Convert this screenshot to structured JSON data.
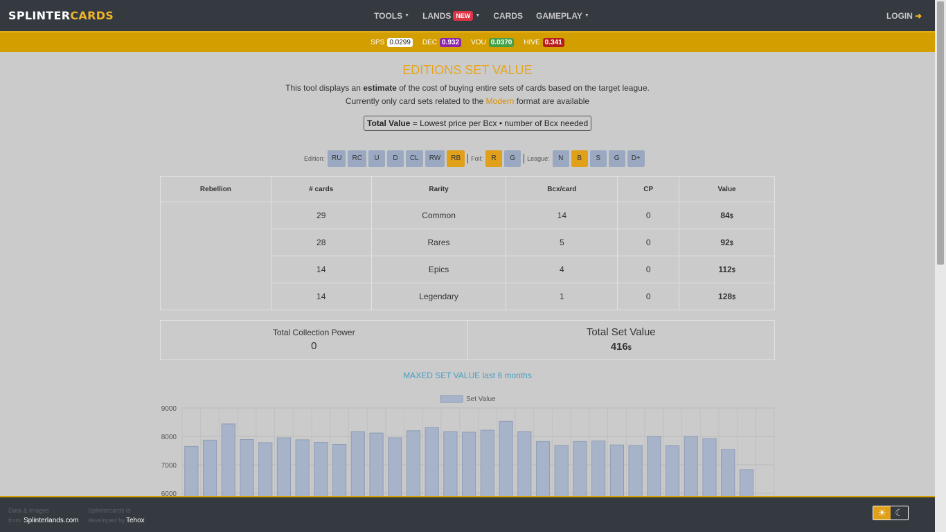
{
  "brand": {
    "part1": "SPLINTER",
    "part2": "CARDS"
  },
  "nav": {
    "items": [
      {
        "label": "TOOLS",
        "dropdown": true
      },
      {
        "label": "LANDS",
        "badge": "NEW",
        "dropdown": true
      },
      {
        "label": "CARDS",
        "dropdown": false
      },
      {
        "label": "GAMEPLAY",
        "dropdown": true
      }
    ],
    "login": "LOGIN"
  },
  "prices": [
    {
      "symbol": "SPS",
      "value": "0.0299",
      "color": "#ffffff"
    },
    {
      "symbol": "DEC",
      "value": "0.932",
      "color": "#8e24aa"
    },
    {
      "symbol": "VOU",
      "value": "0.0370",
      "color": "#43a047"
    },
    {
      "symbol": "HIVE",
      "value": "0.341",
      "color": "#b71c1c"
    }
  ],
  "header": {
    "title": "EDITIONS SET VALUE",
    "line1_pre": "This tool displays an ",
    "line1_bold": "estimate",
    "line1_post": " of the cost of buying entire sets of cards based on the target league.",
    "line2_pre": "Currently only card sets related to the ",
    "line2_hl": "Modern",
    "line2_post": " format are available",
    "formula_bold": "Total Value",
    "formula_rest": " = Lowest price per Bcx • number of Bcx needed"
  },
  "filters": {
    "edition_label": "Edition:",
    "editions": [
      {
        "label": "RU",
        "active": false
      },
      {
        "label": "RC",
        "active": false
      },
      {
        "label": "U",
        "active": false
      },
      {
        "label": "D",
        "active": false
      },
      {
        "label": "CL",
        "active": false
      },
      {
        "label": "RW",
        "active": false
      },
      {
        "label": "RB",
        "active": true
      }
    ],
    "foil_label": "Foil:",
    "foils": [
      {
        "label": "R",
        "active": true
      },
      {
        "label": "G",
        "active": false
      }
    ],
    "league_label": "League:",
    "leagues": [
      {
        "label": "N",
        "active": false
      },
      {
        "label": "B",
        "active": true
      },
      {
        "label": "S",
        "active": false
      },
      {
        "label": "G",
        "active": false
      },
      {
        "label": "D+",
        "active": false
      }
    ]
  },
  "table": {
    "edition": "Rebellion",
    "headers": [
      "# cards",
      "Rarity",
      "Bcx/card",
      "CP",
      "Value"
    ],
    "rows": [
      {
        "cards": "29",
        "rarity": "Common",
        "bcx": "14",
        "cp": "0",
        "value": "84"
      },
      {
        "cards": "28",
        "rarity": "Rares",
        "bcx": "5",
        "cp": "0",
        "value": "92"
      },
      {
        "cards": "14",
        "rarity": "Epics",
        "bcx": "4",
        "cp": "0",
        "value": "112"
      },
      {
        "cards": "14",
        "rarity": "Legendary",
        "bcx": "1",
        "cp": "0",
        "value": "128"
      }
    ],
    "currency": "$"
  },
  "totals": {
    "cp_label": "Total Collection Power",
    "cp_value": "0",
    "set_label": "Total Set Value",
    "set_value": "416",
    "currency": "$"
  },
  "chart_title": "MAXED SET VALUE last 6 months",
  "chart_data": {
    "type": "bar",
    "series": [
      {
        "name": "Set Value",
        "values": [
          7650,
          7870,
          8440,
          7890,
          7780,
          7950,
          7880,
          7790,
          7720,
          8170,
          8120,
          7950,
          8200,
          8310,
          8170,
          8150,
          8220,
          8530,
          8170,
          7820,
          7680,
          7820,
          7840,
          7700,
          7680,
          7990,
          7670,
          8000,
          7920,
          7540,
          6830
        ]
      }
    ],
    "y_ticks": [
      6000,
      7000,
      8000,
      9000
    ],
    "ylim": [
      5800,
      9000
    ],
    "legend": "top-center",
    "grid": true,
    "color": "#a6b3c8"
  },
  "footer": {
    "col1_line1": "Data & images",
    "col1_line2": "from",
    "col1_link": "Splinterlands.com",
    "col2_line1": "Splintercards is",
    "col2_line2": "developed by",
    "col2_link": "Tehox"
  }
}
